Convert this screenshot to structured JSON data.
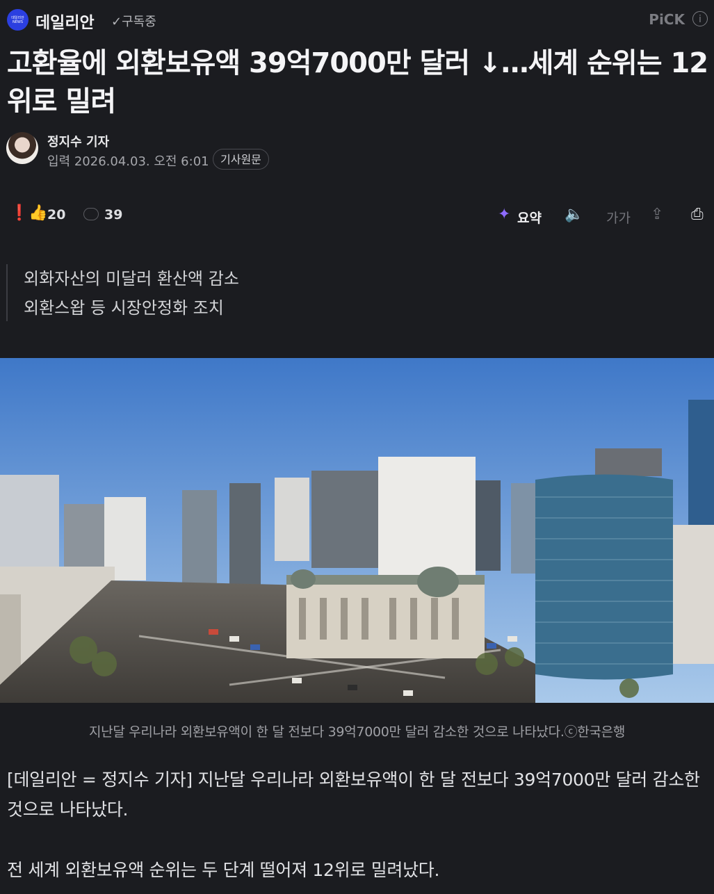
{
  "header": {
    "press_logo_text": "데일리안 NEWS",
    "press_name": "데일리안",
    "subscribe_label": "✓구독중",
    "pick_label": "PiCK",
    "info_icon": "info-icon"
  },
  "article": {
    "headline": "고환율에 외환보유액 39억7000만 달러 ↓…세계 순위는 12위로 밀려",
    "reporter": "정지수 기자",
    "dateline": "입력 2026.04.03. 오전 6:01",
    "origin_button": "기사원문"
  },
  "toolbar": {
    "reaction_count": "20",
    "comment_count": "39",
    "summary_label": "요약",
    "font_icon_label": "가가",
    "icons": [
      "reaction-icon",
      "comment-icon",
      "summary-icon",
      "speaker-icon",
      "font-size-icon",
      "share-icon",
      "print-icon"
    ]
  },
  "summary": {
    "lines": [
      "외화자산의 미달러 환산액 감소",
      "외환스왑 등 시장안정화 조치"
    ]
  },
  "photo": {
    "caption": "지난달 우리나라 외환보유액이 한 달 전보다 39억7000만 달러 감소한 것으로 나타났다.ⓒ한국은행"
  },
  "body": {
    "p1": "[데일리안 = 정지수 기자] 지난달 우리나라 외환보유액이 한 달 전보다 39억7000만 달러 감소한 것으로 나타났다.",
    "p2": "전 세계 외환보유액 순위는 두 단계 떨어져 12위로 밀려났다."
  },
  "colors": {
    "background": "#1b1c20",
    "text": "#e6e6e8",
    "muted": "#a6a7ac",
    "accent": "#2b3fe0"
  }
}
